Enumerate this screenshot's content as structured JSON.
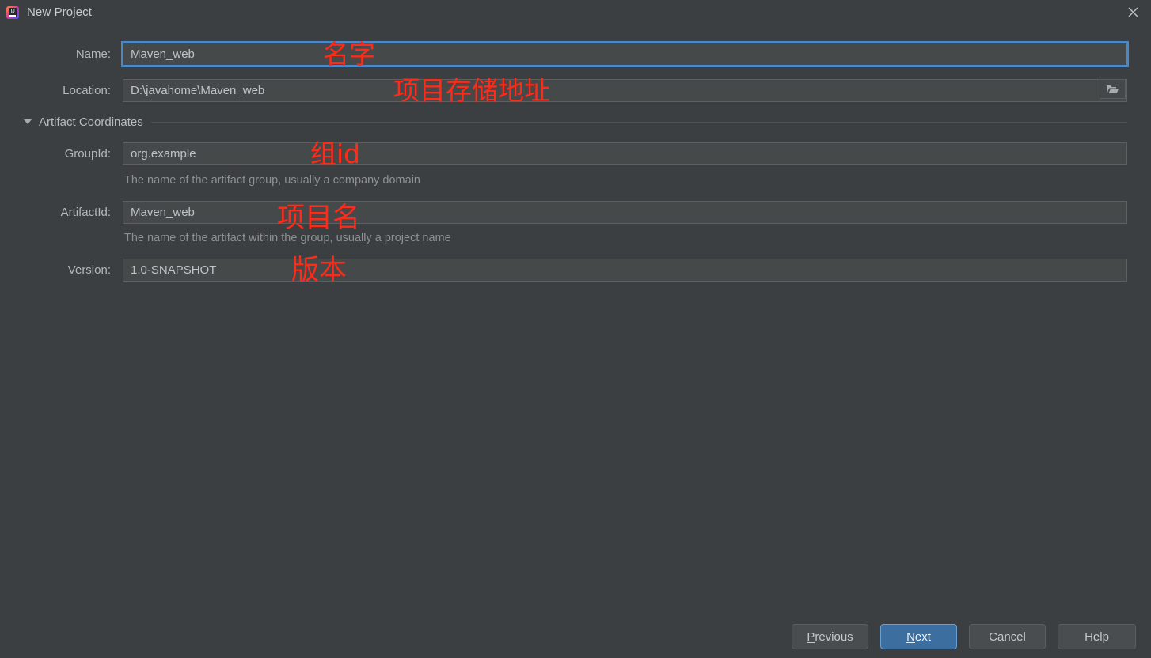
{
  "window": {
    "title": "New Project",
    "app_icon": "intellij-idea-icon",
    "close_icon": "close-icon"
  },
  "form": {
    "name": {
      "label": "Name:",
      "value": "Maven_web",
      "placeholder": "",
      "focused": true
    },
    "location": {
      "label": "Location:",
      "value": "D:\\javahome\\Maven_web",
      "placeholder": "",
      "browse_icon": "folder-open-icon"
    },
    "artifact_section": {
      "label": "Artifact Coordinates",
      "expanded": true,
      "arrow_icon": "triangle-down-icon"
    },
    "group_id": {
      "label": "GroupId:",
      "value": "org.example",
      "hint": "The name of the artifact group, usually a company domain"
    },
    "artifact_id": {
      "label": "ArtifactId:",
      "value": "Maven_web",
      "hint": "The name of the artifact within the group, usually a project name"
    },
    "version": {
      "label": "Version:",
      "value": "1.0-SNAPSHOT"
    }
  },
  "annotations": [
    {
      "text": "名字",
      "target": "name"
    },
    {
      "text": "项目存储地址",
      "target": "location"
    },
    {
      "text": "组id",
      "target": "group_id"
    },
    {
      "text": "项目名",
      "target": "artifact_id"
    },
    {
      "text": "版本",
      "target": "version"
    }
  ],
  "buttons": {
    "previous": {
      "label": "Previous",
      "mnemonic": "P"
    },
    "next": {
      "label": "Next",
      "mnemonic": "N",
      "primary": true
    },
    "cancel": {
      "label": "Cancel"
    },
    "help": {
      "label": "Help"
    }
  },
  "colors": {
    "background": "#3c3f41",
    "field_background": "#45494a",
    "field_border": "#5e6060",
    "focus_blue": "#4a88c7",
    "primary_button": "#3c6e9f",
    "annotation_red": "#ff2a17",
    "text": "#bbbbbb",
    "hint_text": "#8e9194"
  }
}
